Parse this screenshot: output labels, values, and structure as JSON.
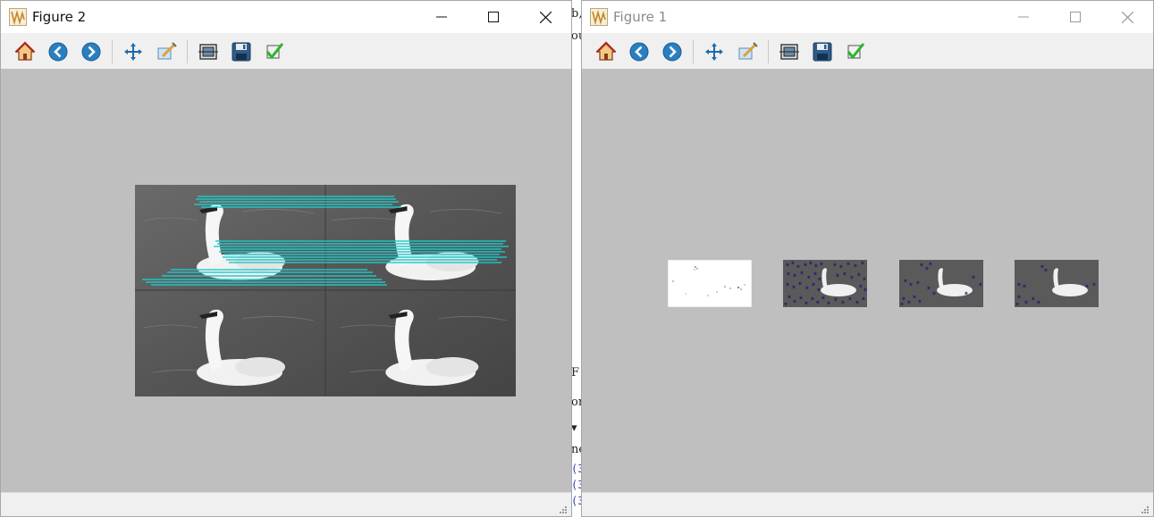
{
  "background_window": {
    "fragments": [
      "b,",
      "ou",
      "F",
      "or",
      "ne",
      "(3",
      "(3",
      "(3"
    ]
  },
  "figure2": {
    "title": "Figure 2",
    "controls": {
      "minimize": "—",
      "maximize": "☐",
      "close": "✕"
    },
    "toolbar": [
      "home-icon",
      "back-arrow-icon",
      "forward-arrow-icon",
      "pan-icon",
      "zoom-icon",
      "subplots-icon",
      "save-icon",
      "check-icon"
    ],
    "canvas_content": "swan feature match image with cyan match lines",
    "colors": {
      "match_lines": "#1fc9c9",
      "canvas_bg": "#bfbfbf"
    }
  },
  "figure1": {
    "title": "Figure 1",
    "controls": {
      "minimize": "—",
      "maximize": "☐",
      "close": "✕"
    },
    "toolbar": [
      "home-icon",
      "back-arrow-icon",
      "forward-arrow-icon",
      "pan-icon",
      "zoom-icon",
      "subplots-icon",
      "save-icon",
      "check-icon"
    ],
    "thumbnails": [
      "binary-mask",
      "keypoints-dense",
      "keypoints-medium",
      "keypoints-sparse"
    ],
    "colors": {
      "keypoint_stars": "#1a1a6e",
      "canvas_bg": "#bfbfbf"
    }
  }
}
